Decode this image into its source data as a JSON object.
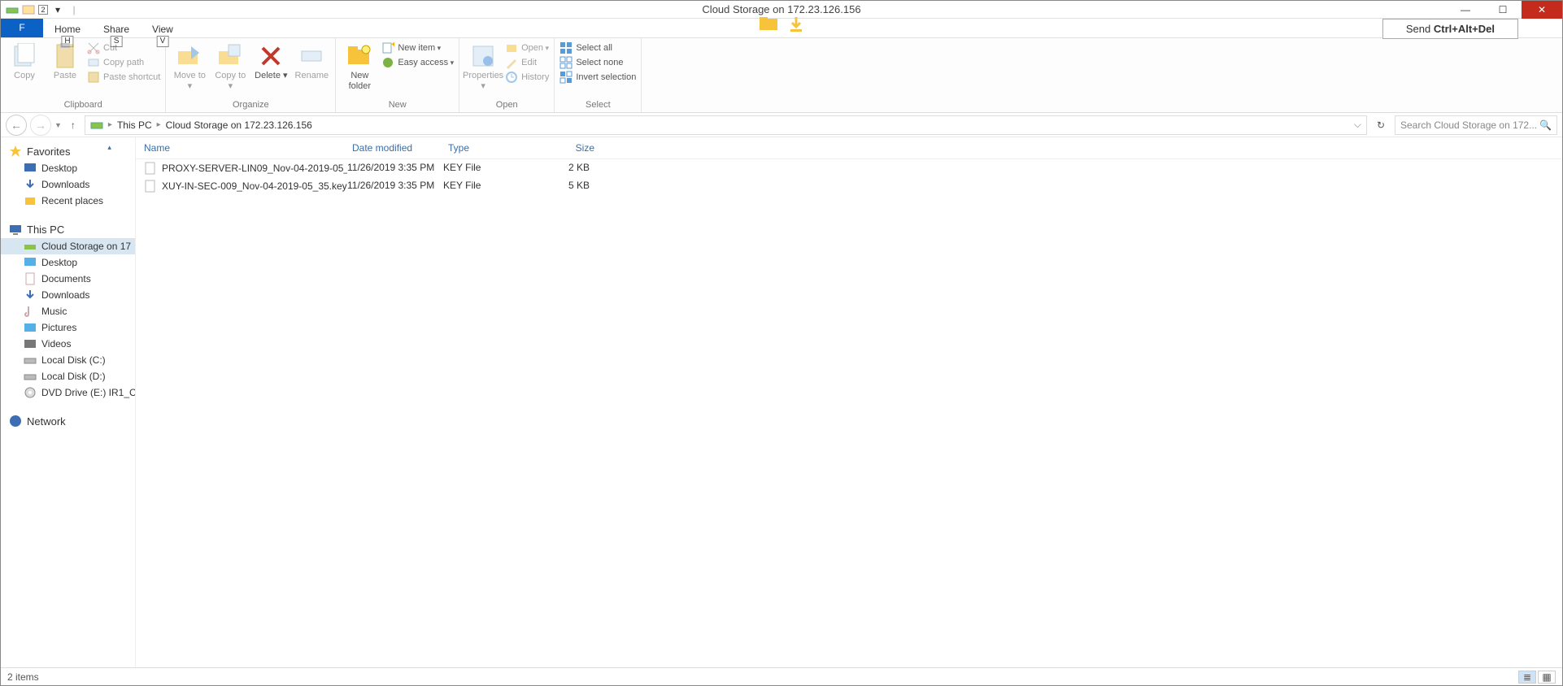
{
  "window": {
    "title": "Cloud Storage on 172.23.126.156",
    "send_cad": "Send Ctrl+Alt+Del"
  },
  "tabs": {
    "file": "F",
    "home": "Home",
    "home_key": "H",
    "share": "Share",
    "share_key": "S",
    "view": "View",
    "view_key": "V"
  },
  "ribbon": {
    "clipboard": {
      "copy": "Copy",
      "paste": "Paste",
      "cut": "Cut",
      "copy_path": "Copy path",
      "paste_shortcut": "Paste shortcut",
      "label": "Clipboard"
    },
    "organize": {
      "move_to": "Move to",
      "copy_to": "Copy to",
      "delete": "Delete",
      "rename": "Rename",
      "label": "Organize"
    },
    "new": {
      "new_folder": "New folder",
      "new_item": "New item",
      "easy_access": "Easy access",
      "label": "New"
    },
    "open": {
      "properties": "Properties",
      "open": "Open",
      "edit": "Edit",
      "history": "History",
      "label": "Open"
    },
    "select": {
      "select_all": "Select all",
      "select_none": "Select none",
      "invert": "Invert selection",
      "label": "Select"
    }
  },
  "breadcrumb": {
    "pc": "This PC",
    "loc": "Cloud Storage on 172.23.126.156"
  },
  "search": {
    "placeholder": "Search Cloud Storage on 172..."
  },
  "columns": {
    "name": "Name",
    "date": "Date modified",
    "type": "Type",
    "size": "Size"
  },
  "rows": [
    {
      "name": "PROXY-SERVER-LIN09_Nov-04-2019-05_...",
      "date": "11/26/2019 3:35 PM",
      "type": "KEY File",
      "size": "2 KB"
    },
    {
      "name": "XUY-IN-SEC-009_Nov-04-2019-05_35.key",
      "date": "11/26/2019 3:35 PM",
      "type": "KEY File",
      "size": "5 KB"
    }
  ],
  "nav": {
    "favorites": "Favorites",
    "fav_items": [
      "Desktop",
      "Downloads",
      "Recent places"
    ],
    "this_pc": "This PC",
    "pc_items": [
      "Cloud Storage on 17",
      "Desktop",
      "Documents",
      "Downloads",
      "Music",
      "Pictures",
      "Videos",
      "Local Disk (C:)",
      "Local Disk (D:)",
      "DVD Drive (E:) IR1_C"
    ],
    "network": "Network"
  },
  "status": {
    "items": "2 items"
  }
}
